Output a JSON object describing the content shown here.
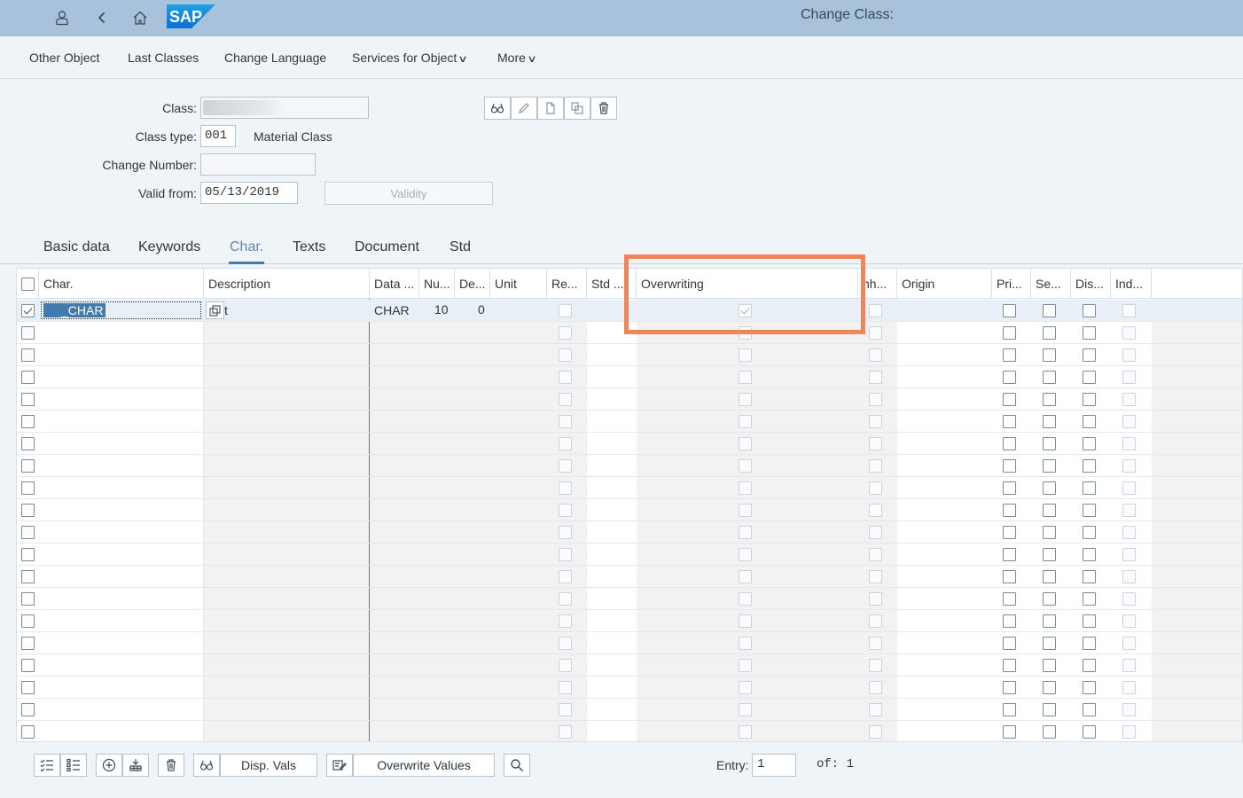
{
  "shell": {
    "title": "Change Class:",
    "logo_text": "SAP"
  },
  "toolbar": {
    "items": [
      "Other Object",
      "Last Classes",
      "Change Language",
      "Services for Object",
      "More"
    ]
  },
  "form": {
    "class_label": "Class:",
    "class_type_label": "Class type:",
    "class_type_value": "001",
    "class_type_desc": "Material Class",
    "change_number_label": "Change Number:",
    "change_number_value": "",
    "valid_from_label": "Valid from:",
    "valid_from_value": "05/13/2019",
    "validity_button": "Validity"
  },
  "tabs": [
    "Basic data",
    "Keywords",
    "Char.",
    "Texts",
    "Document",
    "Std"
  ],
  "active_tab": "Char.",
  "grid": {
    "headers": {
      "char": "Char.",
      "description": "Description",
      "data_type": "Data ...",
      "num": "Nu...",
      "dec": "De...",
      "unit": "Unit",
      "req": "Re...",
      "std": "Std ...",
      "overwriting": "Overwriting",
      "inh": "nh...",
      "origin": "Origin",
      "pri": "Pri...",
      "se": "Se...",
      "dis": "Dis...",
      "ind": "Ind..."
    },
    "first_row": {
      "char": "_CHAR",
      "description": "t",
      "data_type": "CHAR",
      "num": "10",
      "dec": "0",
      "selected": true,
      "overwriting_checked": true
    },
    "empty_rows": 19
  },
  "bottom": {
    "disp_vals": "Disp. Vals",
    "overwrite_values": "Overwrite Values",
    "entry_label": "Entry:",
    "entry_value": "1",
    "of_label": "of: 1"
  },
  "colors": {
    "shell": "#a8c2db",
    "highlight": "#f0845a",
    "accent": "#427cac"
  }
}
